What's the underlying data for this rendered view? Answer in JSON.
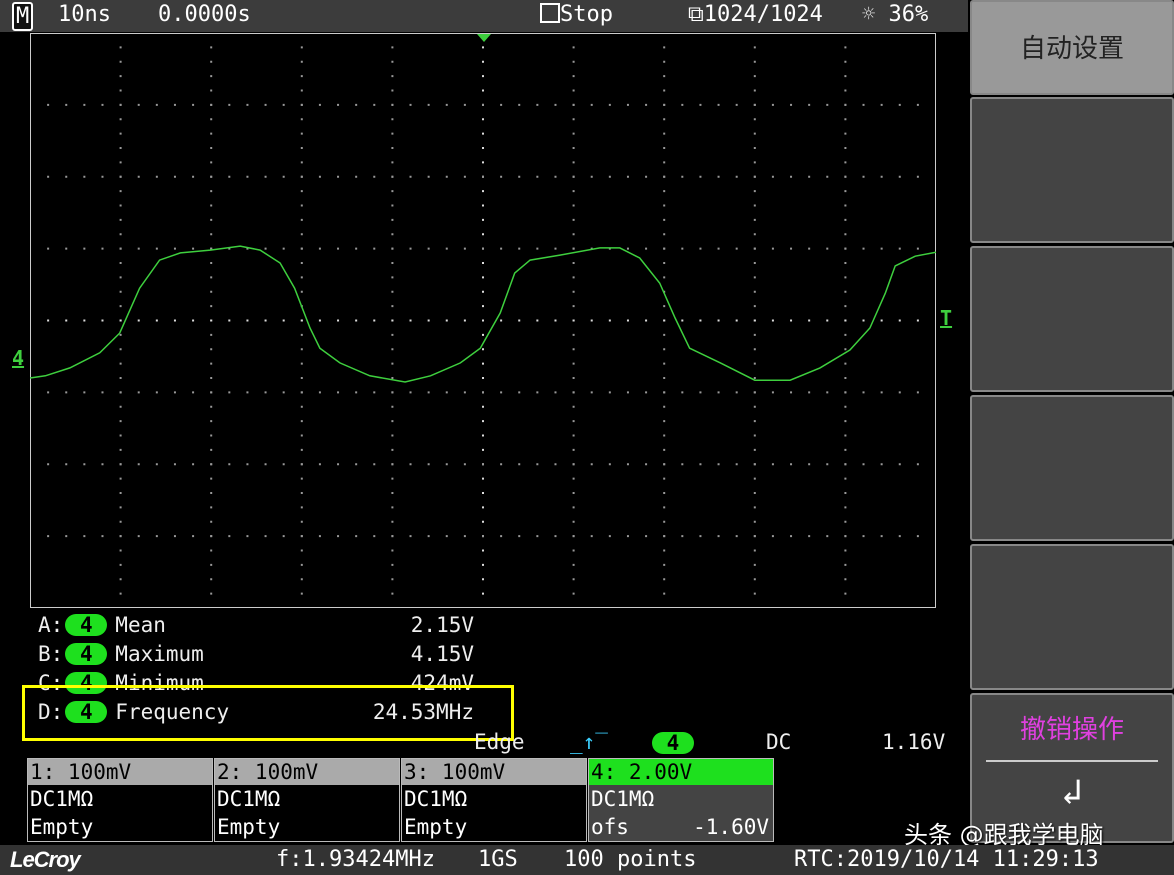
{
  "topbar": {
    "mode": "M",
    "timebase": "10ns",
    "delay": "0.0000s",
    "run_state": "Stop",
    "acquisitions": "1024/1024",
    "brightness": "36%"
  },
  "side_menu": {
    "auto_setup": "自动设置",
    "undo": "撤销操作"
  },
  "measurements": [
    {
      "slot": "A:",
      "channel": "4",
      "name": "Mean",
      "value": "2.15V"
    },
    {
      "slot": "B:",
      "channel": "4",
      "name": "Maximum",
      "value": "4.15V"
    },
    {
      "slot": "C:",
      "channel": "4",
      "name": "Minimum",
      "value": "424mV"
    },
    {
      "slot": "D:",
      "channel": "4",
      "name": "Frequency",
      "value": "24.53MHz"
    }
  ],
  "trigger": {
    "type": "Edge",
    "channel": "4",
    "coupling": "DC",
    "level": "1.16V",
    "marker": "T"
  },
  "channels": [
    {
      "header": "1: 100mV",
      "coupling": "DC1MΩ",
      "extra": "Empty",
      "extra_value": ""
    },
    {
      "header": "2: 100mV",
      "coupling": "DC1MΩ",
      "extra": "Empty",
      "extra_value": ""
    },
    {
      "header": "3: 100mV",
      "coupling": "DC1MΩ",
      "extra": "Empty",
      "extra_value": ""
    },
    {
      "header": "4: 2.00V",
      "coupling": "DC1MΩ",
      "extra": "ofs",
      "extra_value": "-1.60V"
    }
  ],
  "ground_marker": "4",
  "status": {
    "brand": "LeCroy",
    "frequency": "f:1.93424MHz",
    "sample_rate": "1GS",
    "points": "100 points",
    "rtc": "RTC:2019/10/14 11:29:13"
  },
  "watermark": "头条 @跟我学电脑",
  "colors": {
    "trace": "#3ecf3e",
    "highlight": "#ffff00",
    "undo": "#e040e0"
  },
  "trace": {
    "time_ns": [
      -50,
      -48.3,
      -45.6,
      -42.3,
      -40.1,
      -37.9,
      -35.7,
      -33.4,
      -30.1,
      -26.8,
      -24.6,
      -22.4,
      -20.8,
      -19.1,
      -18,
      -15.8,
      -12.5,
      -8.6,
      -5.8,
      -2.5,
      -0.3,
      1.9,
      3.5,
      5.2,
      8.5,
      12.9,
      15.1,
      17.3,
      19.5,
      21.2,
      22.8,
      26.2,
      30,
      33.9,
      37.2,
      40.5,
      42.7,
      44.4,
      45.5,
      47.7,
      50
    ],
    "volts": [
      0,
      0.06,
      0.28,
      0.7,
      1.25,
      2.5,
      3.28,
      3.48,
      3.56,
      3.67,
      3.56,
      3.2,
      2.5,
      1.39,
      0.83,
      0.42,
      0.06,
      -0.11,
      0.06,
      0.42,
      0.83,
      1.81,
      2.92,
      3.28,
      3.42,
      3.62,
      3.62,
      3.34,
      2.64,
      1.67,
      0.83,
      0.42,
      -0.06,
      -0.06,
      0.28,
      0.78,
      1.39,
      2.36,
      3.12,
      3.39,
      3.5
    ]
  }
}
